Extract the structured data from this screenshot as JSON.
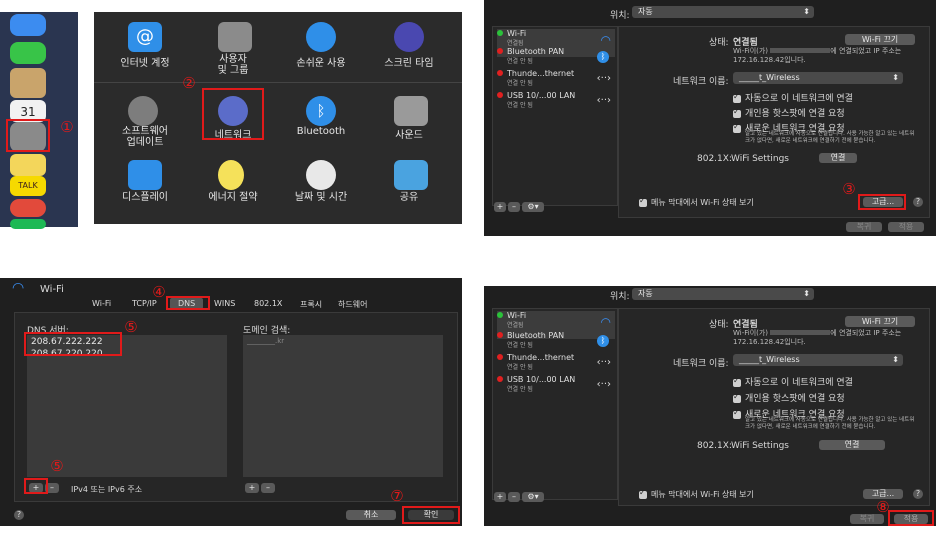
{
  "step_badges": [
    "①",
    "②",
    "③",
    "④",
    "⑤",
    "⑤",
    "⑦",
    "⑧"
  ],
  "prefs_panel": {
    "items": [
      {
        "label": "인터넷 계정",
        "icon": "at-icon"
      },
      {
        "label": "사용자\n및 그룹",
        "icon": "users-icon"
      },
      {
        "label": "손쉬운 사용",
        "icon": "accessibility-icon"
      },
      {
        "label": "스크린 타임",
        "icon": "hourglass-icon"
      },
      {
        "label": "소프트웨어\n업데이트",
        "icon": "gear-icon"
      },
      {
        "label": "네트워크",
        "icon": "globe-icon"
      },
      {
        "label": "Bluetooth",
        "icon": "bluetooth-icon"
      },
      {
        "label": "사운드",
        "icon": "speaker-icon"
      },
      {
        "label": "디스플레이",
        "icon": "display-icon"
      },
      {
        "label": "에너지 절약",
        "icon": "bulb-icon"
      },
      {
        "label": "날짜 및 시간",
        "icon": "clock-icon"
      },
      {
        "label": "공유",
        "icon": "folder-icon"
      }
    ]
  },
  "network": {
    "location_label": "위치:",
    "location_value": "자동",
    "services": [
      {
        "name": "Wi-Fi",
        "status": "연결됨",
        "color": "#2bc23a"
      },
      {
        "name": "Bluetooth PAN",
        "status": "연결 안 됨",
        "color": "#e02020"
      },
      {
        "name": "Thunde...thernet",
        "status": "연결 안 됨",
        "color": "#e02020"
      },
      {
        "name": "USB 10/...00 LAN",
        "status": "연결 안 됨",
        "color": "#e02020"
      }
    ],
    "status_label": "상태:",
    "status_value": "연결됨",
    "wifi_off_button": "Wi-Fi 끄기",
    "status_desc_1": "Wi-Fi이(가)",
    "status_desc_2": "에 연결되었고 IP 주소는",
    "status_desc_3": "172.16.128.42입니다.",
    "network_name_label": "네트워크 이름:",
    "network_name_value": "_____t_Wireless",
    "check1": "자동으로 이 네트워크에 연결",
    "check2": "개인용 핫스팟에 연결 요청",
    "check3": "새로운 네트워크 연결 요청",
    "check3_desc": "알고 있는 네트워크에 자동으로 연결됩니다. 사용 가능한 알고 있는 네트워크가 없다면, 새로운 네트워크에 연결하기 전에 묻습니다.",
    "dot1x_label": "802.1X:",
    "dot1x_value": "WiFi Settings",
    "connect_button": "연결",
    "menu_check": "메뉴 막대에서 Wi-Fi 상태 보기",
    "advanced_button": "고급...",
    "help": "?",
    "revert_button": "복귀",
    "apply_button": "적용",
    "bottom_controls": [
      "+",
      "–",
      "⚙▾"
    ]
  },
  "dns_panel": {
    "title": "Wi-Fi",
    "tabs": [
      "Wi-Fi",
      "TCP/IP",
      "DNS",
      "WINS",
      "802.1X",
      "프록시",
      "하드웨어"
    ],
    "dns_label": "DNS 서버:",
    "dns_servers": [
      "208.67.222.222",
      "208.67.220.220"
    ],
    "search_label": "도메인 검색:",
    "search_domain": "________.kr",
    "add": "+",
    "remove": "–",
    "hint": "IPv4 또는 IPv6 주소",
    "cancel": "취소",
    "ok": "확인",
    "help": "?"
  }
}
